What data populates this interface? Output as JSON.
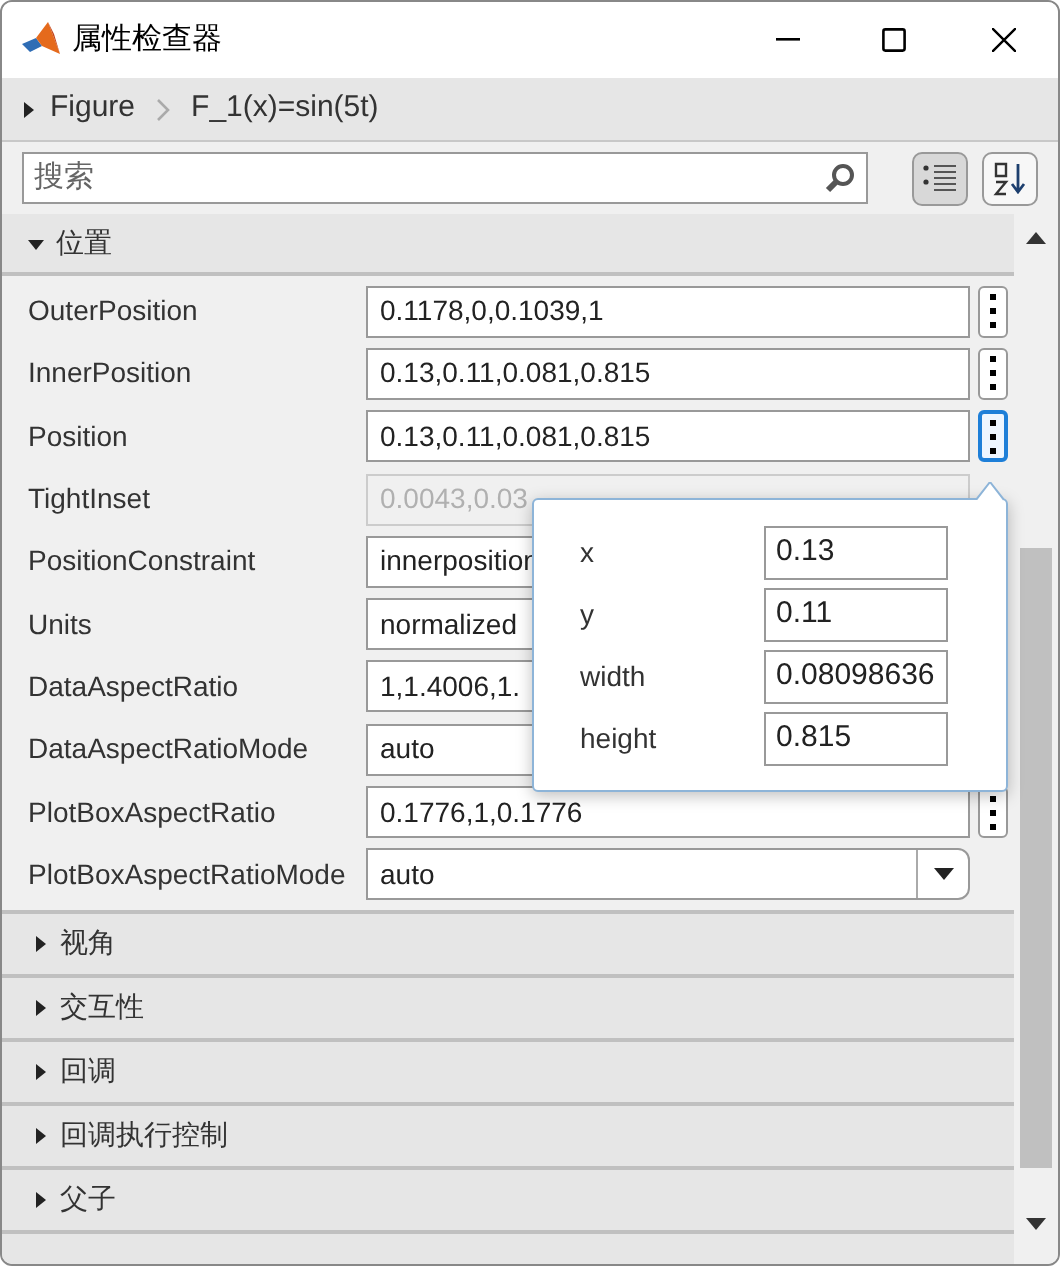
{
  "window": {
    "title": "属性检查器"
  },
  "breadcrumb": [
    "Figure",
    "F_1(x)=sin(5t)"
  ],
  "search": {
    "placeholder": "搜索"
  },
  "toolbar": [
    {
      "kind": "categorized",
      "selected": true
    },
    {
      "kind": "alphabetical",
      "selected": false
    }
  ],
  "section": {
    "title": "位置",
    "expanded": true
  },
  "properties": [
    {
      "name": "OuterPosition",
      "value": "0.1178,0,0.1039,1",
      "kind": "text_more",
      "disabled": false,
      "active": false
    },
    {
      "name": "InnerPosition",
      "value": "0.13,0.11,0.081,0.815",
      "kind": "text_more",
      "disabled": false,
      "active": false
    },
    {
      "name": "Position",
      "value": "0.13,0.11,0.081,0.815",
      "kind": "text_more",
      "disabled": false,
      "active": true
    },
    {
      "name": "TightInset",
      "value": "0.0043,0.03",
      "kind": "text",
      "disabled": true
    },
    {
      "name": "PositionConstraint",
      "value": "innerposition",
      "kind": "text",
      "disabled": false
    },
    {
      "name": "Units",
      "value": "normalized",
      "kind": "text",
      "disabled": false
    },
    {
      "name": "DataAspectRatio",
      "value": "1,1.4006,1.",
      "kind": "text",
      "disabled": false
    },
    {
      "name": "DataAspectRatioMode",
      "value": "auto",
      "kind": "text",
      "disabled": false
    },
    {
      "name": "PlotBoxAspectRatio",
      "value": "0.1776,1,0.1776",
      "kind": "text_more",
      "disabled": false,
      "active": false
    },
    {
      "name": "PlotBoxAspectRatioMode",
      "value": "auto",
      "kind": "dropdown",
      "disabled": false
    }
  ],
  "popover": {
    "fields": [
      {
        "label": "x",
        "value": "0.13"
      },
      {
        "label": "y",
        "value": "0.11"
      },
      {
        "label": "width",
        "value": "0.08098636"
      },
      {
        "label": "height",
        "value": "0.815"
      }
    ]
  },
  "collapsed_sections": [
    {
      "title": "视角",
      "expanded": false
    },
    {
      "title": "交互性",
      "expanded": false
    },
    {
      "title": "回调",
      "expanded": false
    },
    {
      "title": "回调执行控制",
      "expanded": false
    },
    {
      "title": "父子",
      "expanded": false
    }
  ]
}
